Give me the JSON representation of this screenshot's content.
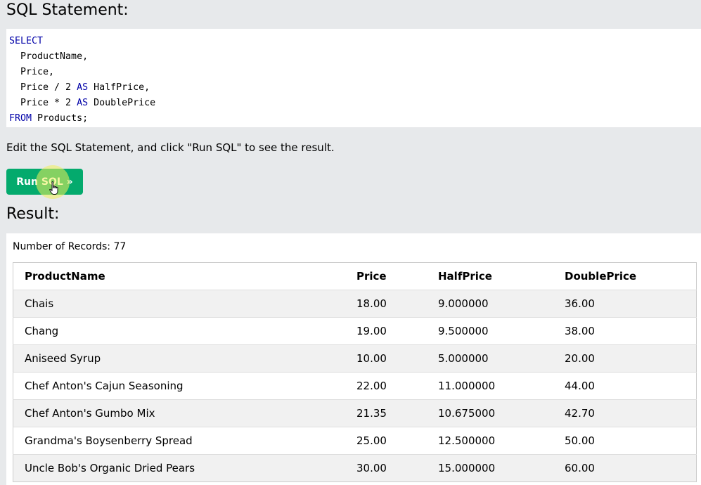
{
  "sql_heading": "SQL Statement:",
  "code_lines": [
    [
      {
        "t": "SELECT",
        "k": true
      }
    ],
    [
      {
        "t": "  ProductName,",
        "k": false
      }
    ],
    [
      {
        "t": "  Price,",
        "k": false
      }
    ],
    [
      {
        "t": "  Price / 2 ",
        "k": false
      },
      {
        "t": "AS",
        "k": true
      },
      {
        "t": " HalfPrice,",
        "k": false
      }
    ],
    [
      {
        "t": "  Price * 2 ",
        "k": false
      },
      {
        "t": "AS",
        "k": true
      },
      {
        "t": " DoublePrice",
        "k": false
      }
    ],
    [
      {
        "t": "FROM",
        "k": true
      },
      {
        "t": " Products;",
        "k": false
      }
    ]
  ],
  "instruction": "Edit the SQL Statement, and click \"Run SQL\" to see the result.",
  "run_button_label": "Run SQL »",
  "result_heading": "Result:",
  "record_count": "Number of Records: 77",
  "table": {
    "columns": [
      "ProductName",
      "Price",
      "HalfPrice",
      "DoublePrice"
    ],
    "rows": [
      [
        "Chais",
        "18.00",
        "9.000000",
        "36.00"
      ],
      [
        "Chang",
        "19.00",
        "9.500000",
        "38.00"
      ],
      [
        "Aniseed Syrup",
        "10.00",
        "5.000000",
        "20.00"
      ],
      [
        "Chef Anton's Cajun Seasoning",
        "22.00",
        "11.000000",
        "44.00"
      ],
      [
        "Chef Anton's Gumbo Mix",
        "21.35",
        "10.675000",
        "42.70"
      ],
      [
        "Grandma's Boysenberry Spread",
        "25.00",
        "12.500000",
        "50.00"
      ],
      [
        "Uncle Bob's Organic Dried Pears",
        "30.00",
        "15.000000",
        "60.00"
      ]
    ]
  },
  "colors": {
    "page_bg": "#e7e9eb",
    "button_green": "#04aa6d",
    "keyword_blue": "#0000a8",
    "row_stripe": "#f1f1f1"
  }
}
